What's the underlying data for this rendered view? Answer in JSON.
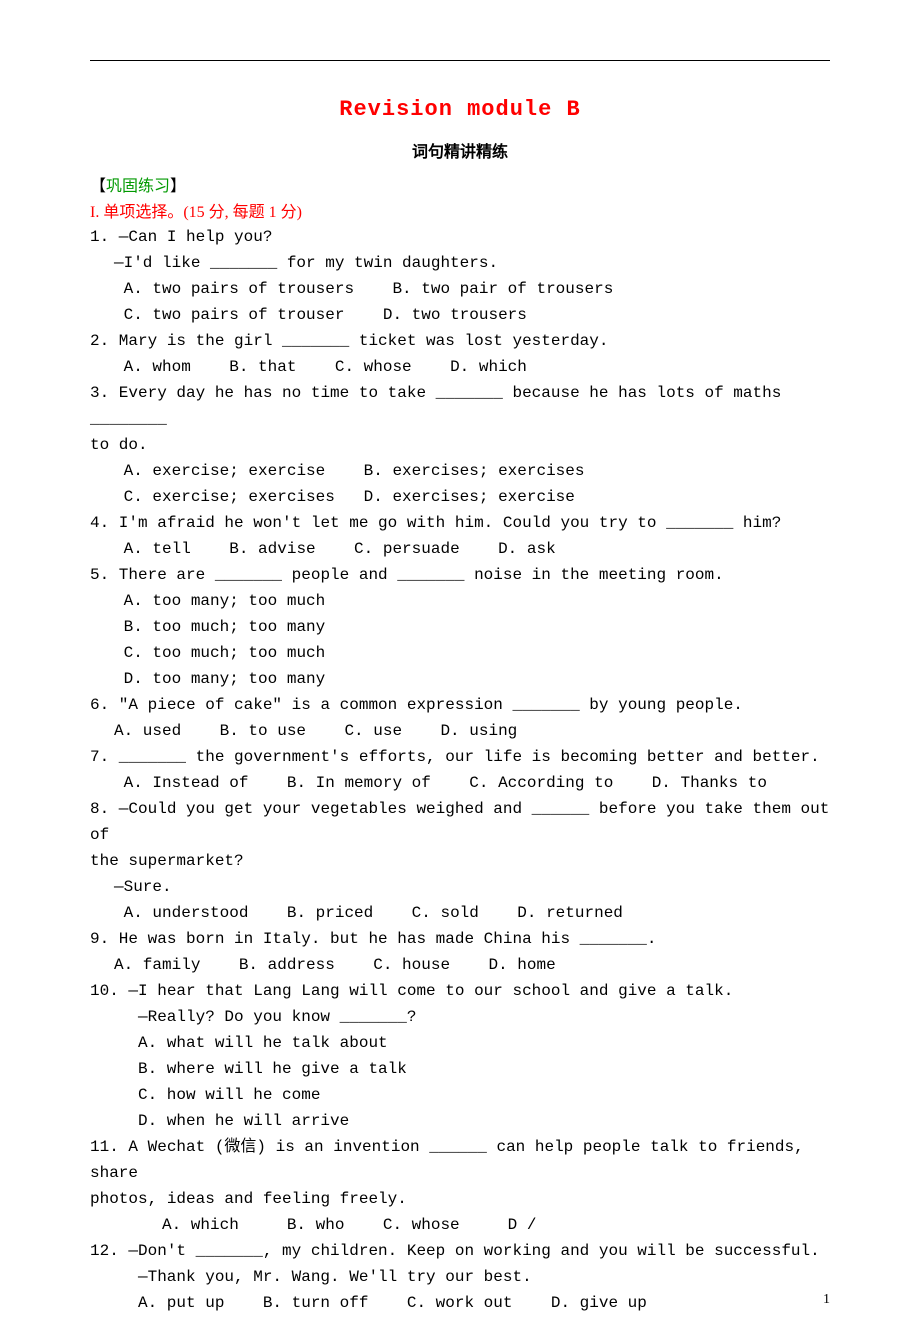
{
  "title": "Revision module B",
  "subtitle": "词句精讲精练",
  "section_marker_open": "【",
  "section_marker_text": "巩固练习",
  "section_marker_close": "】",
  "part1": "I. 单项选择。(15 分, 每题 1 分)",
  "q1": {
    "l1": "1. —Can I help you?",
    "l2": "—I'd like _______ for my twin daughters.",
    "l3": " A. two pairs of trousers    B. two pair of trousers",
    "l4": " C. two pairs of trouser    D. two trousers"
  },
  "q2": {
    "l1": "2. Mary is the girl _______ ticket was lost yesterday.",
    "l2": " A. whom    B. that    C. whose    D. which"
  },
  "q3": {
    "l1": "3. Every day he has no time to take _______ because he has lots of maths ________",
    "l2": "to do.",
    "l3": " A. exercise; exercise    B. exercises; exercises",
    "l4": " C. exercise; exercises   D. exercises; exercise"
  },
  "q4": {
    "l1": "4. I'm afraid he won't let me go with him. Could you try to _______ him?",
    "l2": " A. tell    B. advise    C. persuade    D. ask"
  },
  "q5": {
    "l1": "5. There are _______ people and _______ noise in the meeting room.",
    "l2": " A. too many; too much",
    "l3": " B. too much; too many",
    "l4": " C. too much; too much",
    "l5": " D. too many; too many"
  },
  "q6": {
    "l1": "6. \"A piece of cake\" is a common expression _______ by young people.",
    "l2": "A. used    B. to use    C. use    D. using"
  },
  "q7": {
    "l1": "7. _______ the government's efforts, our life is becoming better and better.",
    "l2": " A. Instead of    B. In memory of    C. According to    D. Thanks to"
  },
  "q8": {
    "l1": "8. —Could you get your vegetables weighed and ______ before you take them out of",
    "l2": "the supermarket?",
    "l3": "—Sure.",
    "l4": " A. understood    B. priced    C. sold    D. returned"
  },
  "q9": {
    "l1": "9. He was born in Italy. but he has made China his _______.",
    "l2": "A. family    B. address    C. house    D. home"
  },
  "q10": {
    "l1": "10. —I hear that Lang Lang will come to our school and give a talk.",
    "l2": "—Really? Do you know _______?",
    "l3": "A. what will he talk about",
    "l4": "B. where will he give a talk",
    "l5": "C. how will he come",
    "l6": "D. when he will arrive"
  },
  "q11": {
    "l1": "11. A Wechat (微信) is an invention ______ can help people talk to friends, share",
    "l2": "photos, ideas and feeling freely.",
    "l3": "A. which     B. who    C. whose     D /"
  },
  "q12": {
    "l1": "12. —Don't _______, my children. Keep on working and you will be successful.",
    "l2": "—Thank you, Mr. Wang. We'll try our best.",
    "l3": "A. put up    B. turn off    C. work out    D. give up"
  },
  "page_number": "1"
}
